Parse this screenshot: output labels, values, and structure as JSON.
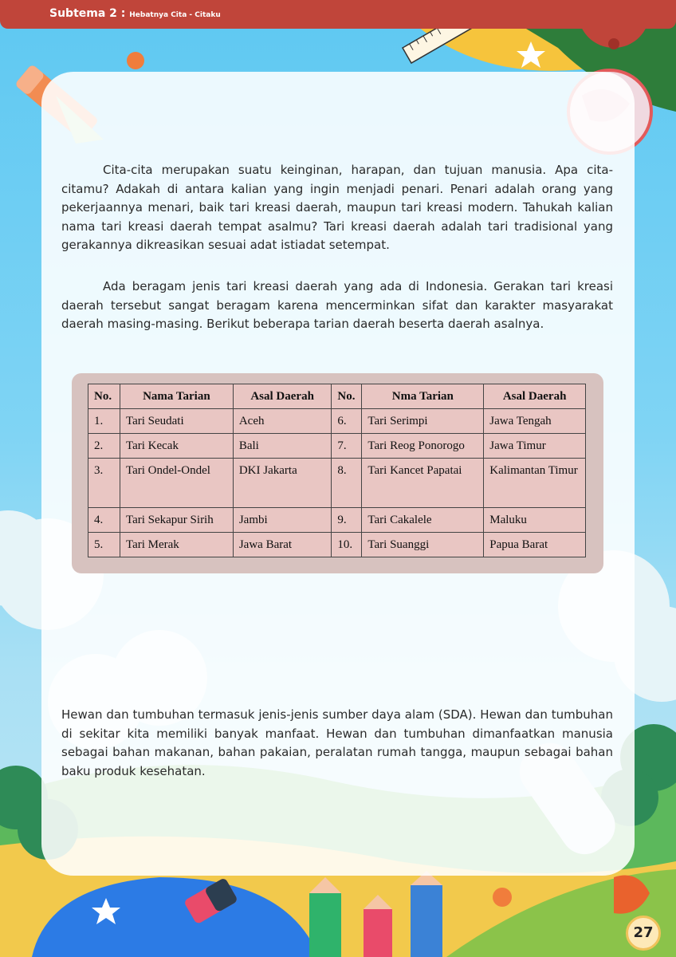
{
  "header": {
    "subtema": "Subtema 2 :",
    "judul": "Hebatnya Cita - Citaku"
  },
  "paragraphs": {
    "p1": "Cita-cita merupakan suatu keinginan, harapan, dan tujuan manusia. Apa cita-citamu? Adakah di antara kalian yang ingin menjadi penari. Penari adalah orang yang pekerjaannya menari, baik tari kreasi daerah, maupun tari kreasi modern. Tahukah kalian nama tari kreasi daerah tempat asalmu? Tari kreasi daerah adalah tari tradisional yang gerakannya dikreasikan sesuai adat istiadat setempat.",
    "p2": "Ada beragam jenis tari kreasi daerah yang ada di Indonesia. Gerakan tari kreasi daerah tersebut sangat beragam karena mencerminkan sifat dan karakter masyarakat daerah masing-masing. Berikut beberapa tarian daerah beserta daerah asalnya.",
    "p3": "Hewan dan tumbuhan termasuk jenis-jenis sumber daya alam (SDA). Hewan dan tumbuhan di sekitar kita memiliki banyak manfaat. Hewan dan tumbuhan dimanfaatkan manusia sebagai bahan makanan, bahan pakaian, peralatan rumah tangga, maupun sebagai bahan baku produk kesehatan."
  },
  "table": {
    "headers": [
      "No.",
      "Nama Tarian",
      "Asal Daerah",
      "No.",
      "Nma Tarian",
      "Asal Daerah"
    ],
    "rows": [
      [
        "1.",
        "Tari Seudati",
        "Aceh",
        "6.",
        "Tari Serimpi",
        "Jawa Tengah"
      ],
      [
        "2.",
        "Tari Kecak",
        "Bali",
        "7.",
        "Tari Reog Ponorogo",
        "Jawa Timur"
      ],
      [
        "3.",
        "Tari Ondel-Ondel",
        "DKI Jakarta",
        "8.",
        "Tari Kancet Papatai",
        "Kalimantan Timur"
      ],
      [
        "4.",
        "Tari Sekapur Sirih",
        "Jambi",
        "9.",
        "Tari Cakalele",
        "Maluku"
      ],
      [
        "5.",
        "Tari Merak",
        "Jawa Barat",
        "10.",
        "Tari Suanggi",
        "Papua Barat"
      ]
    ]
  },
  "page_number": "27",
  "colors": {
    "header_bar": "#c0453a",
    "sky": "#5ec8f2",
    "table_bg": "#e9c6c3",
    "table_frame": "#d7c2bf",
    "page_number_bg": "#fde9b8"
  },
  "icons": [
    "pencil-icon",
    "ruler-icon",
    "globe-icon",
    "star-icon",
    "eraser-icon",
    "crayon-icon",
    "rocket-icon",
    "cloud-icon",
    "bush-icon",
    "tube-icon"
  ]
}
